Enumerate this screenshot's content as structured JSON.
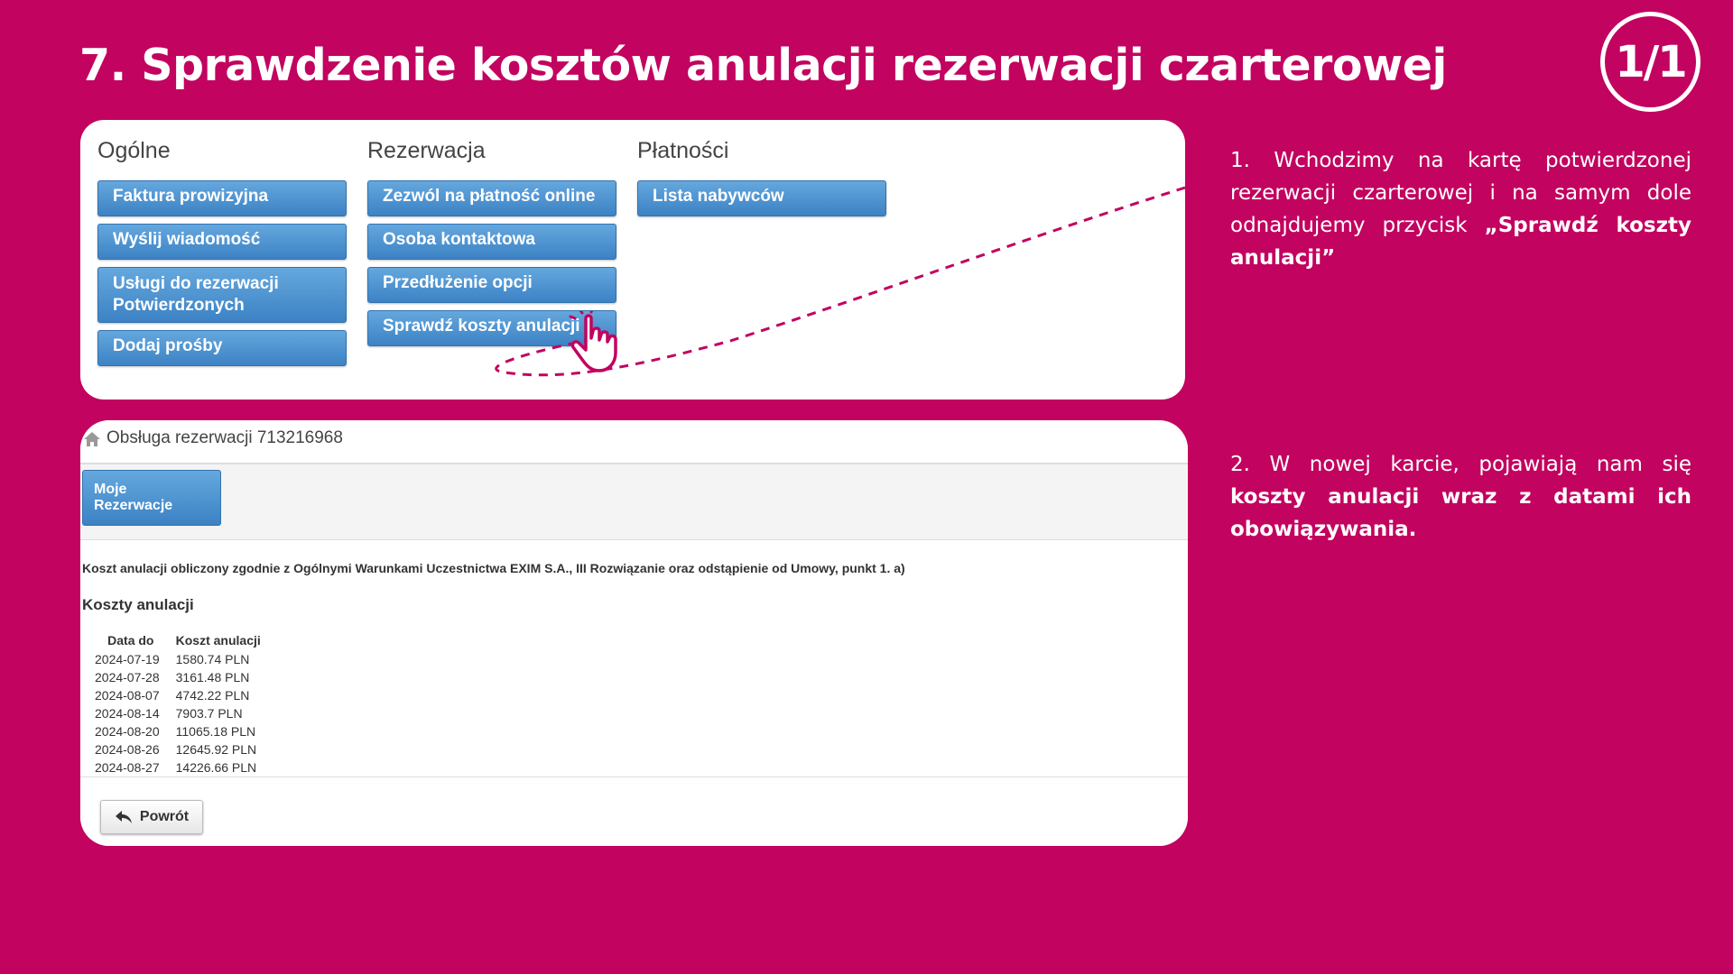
{
  "slide": {
    "title": "7. Sprawdzenie kosztów anulacji rezerwacji czarterowej",
    "page_indicator": "1/1"
  },
  "menu_panel": {
    "columns": [
      {
        "heading": "Ogólne",
        "buttons": [
          "Faktura prowizyjna",
          "Wyślij wiadomość",
          "Usługi do rezerwacji Potwierdzonych",
          "Dodaj prośby"
        ]
      },
      {
        "heading": "Rezerwacja",
        "buttons": [
          "Zezwól na płatność online",
          "Osoba kontaktowa",
          "Przedłużenie opcji",
          "Sprawdź koszty anulacji"
        ]
      },
      {
        "heading": "Płatności",
        "buttons": [
          "Lista nabywców"
        ]
      }
    ]
  },
  "costs_panel": {
    "header_title": "Obsługa rezerwacji 713216968",
    "my_reservations_button": "Moje Rezerwacje",
    "note": "Koszt anulacji obliczony zgodnie z Ogólnymi Warunkami Uczestnictwa EXIM S.A., III Rozwiązanie oraz odstąpienie od Umowy, punkt 1. a)",
    "section_heading": "Koszty anulacji",
    "table": {
      "headers": [
        "Data do",
        "Koszt anulacji"
      ],
      "rows": [
        [
          "2024-07-19",
          "1580.74 PLN"
        ],
        [
          "2024-07-28",
          "3161.48 PLN"
        ],
        [
          "2024-08-07",
          "4742.22 PLN"
        ],
        [
          "2024-08-14",
          "7903.7 PLN"
        ],
        [
          "2024-08-20",
          "11065.18 PLN"
        ],
        [
          "2024-08-26",
          "12645.92 PLN"
        ],
        [
          "2024-08-27",
          "14226.66 PLN"
        ]
      ]
    },
    "back_button": "Powrót"
  },
  "instructions": {
    "step1": {
      "prefix": "1. Wchodzimy na kartę potwierdzonej rezerwacji czarterowej i na samym dole odnajdujemy przycisk ",
      "bold": "„Sprawdź koszty anulacji”"
    },
    "step2": {
      "prefix": "2. W nowej karcie, pojawiają nam się ",
      "bold": "koszty anulacji  wraz z datami ich obowiązywania."
    }
  },
  "colors": {
    "background": "#c2035f",
    "button_blue": "#4a90d0",
    "annotation_dash": "#c2035f"
  }
}
